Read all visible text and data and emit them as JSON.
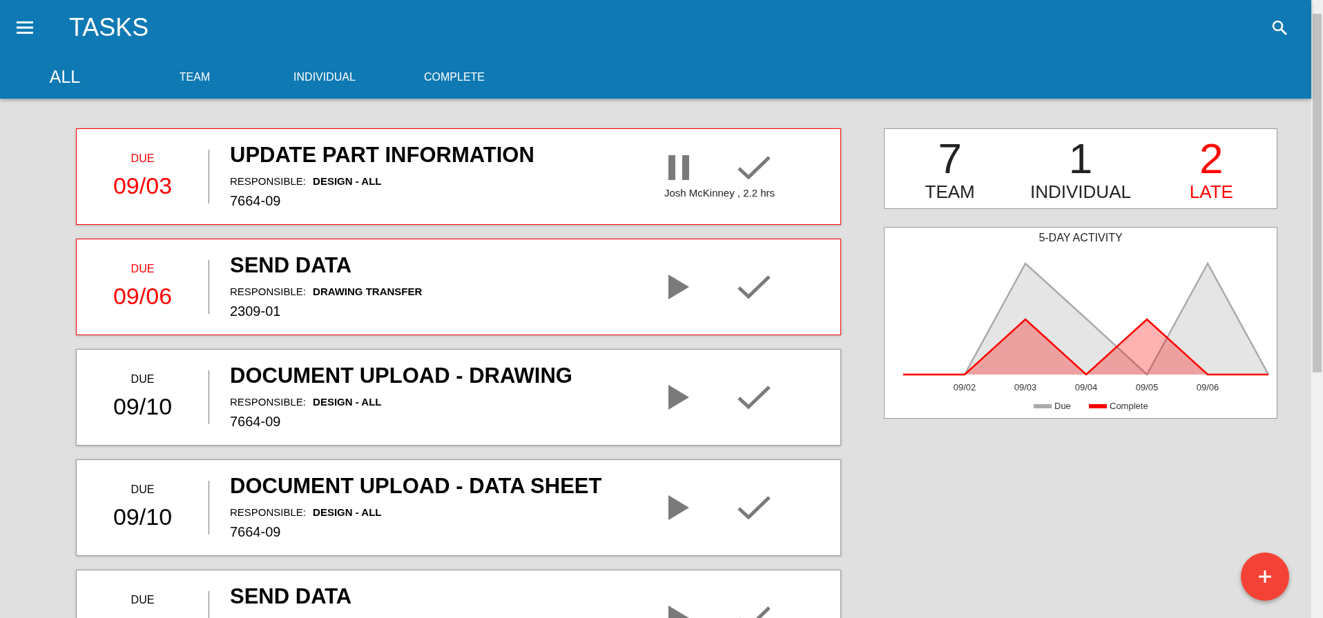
{
  "header": {
    "title": "TASKS"
  },
  "tabs": [
    {
      "label": "ALL",
      "selected": true
    },
    {
      "label": "TEAM",
      "selected": false
    },
    {
      "label": "INDIVIDUAL",
      "selected": false
    },
    {
      "label": "COMPLETE",
      "selected": false
    }
  ],
  "tasks": [
    {
      "due_label": "DUE",
      "date": "09/03",
      "late": true,
      "title": "UPDATE PART INFORMATION",
      "responsible_label": "RESPONSIBLE:",
      "responsible": "DESIGN - ALL",
      "code": "7664-09",
      "in_progress": true,
      "worker": "Josh McKinney , 2.2 hrs"
    },
    {
      "due_label": "DUE",
      "date": "09/06",
      "late": true,
      "title": "SEND DATA",
      "responsible_label": "RESPONSIBLE:",
      "responsible": "DRAWING TRANSFER",
      "code": "2309-01",
      "in_progress": false
    },
    {
      "due_label": "DUE",
      "date": "09/10",
      "late": false,
      "title": "DOCUMENT UPLOAD - DRAWING",
      "responsible_label": "RESPONSIBLE:",
      "responsible": "DESIGN - ALL",
      "code": "7664-09",
      "in_progress": false
    },
    {
      "due_label": "DUE",
      "date": "09/10",
      "late": false,
      "title": "DOCUMENT UPLOAD - DATA SHEET",
      "responsible_label": "RESPONSIBLE:",
      "responsible": "DESIGN - ALL",
      "code": "7664-09",
      "in_progress": false
    },
    {
      "due_label": "DUE",
      "late": false,
      "title": "SEND DATA",
      "in_progress": false
    }
  ],
  "stats": [
    {
      "value": "7",
      "label": "TEAM",
      "late": false
    },
    {
      "value": "1",
      "label": "INDIVIDUAL",
      "late": false
    },
    {
      "value": "2",
      "label": "LATE",
      "late": true
    }
  ],
  "activity": {
    "title": "5-DAY ACTIVITY",
    "x_labels": [
      "09/02",
      "09/03",
      "09/04",
      "09/05",
      "09/06"
    ],
    "legend": [
      {
        "name": "Due",
        "color": "#aaaaaa"
      },
      {
        "name": "Complete",
        "color": "#ff0000"
      }
    ]
  }
}
